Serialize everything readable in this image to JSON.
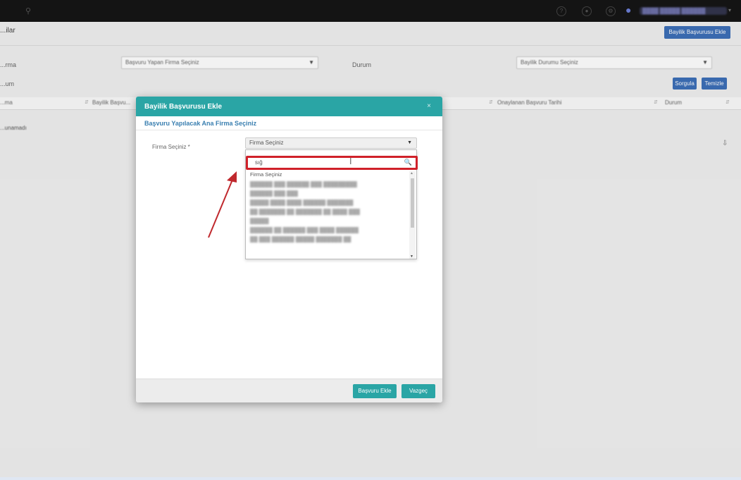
{
  "topbar": {
    "search_icon": "search-icon",
    "user_name": "████ █████ ██████"
  },
  "page": {
    "title": "...ilar",
    "add_button": "Bayilik Başvurusu Ekle",
    "filter_left_label": "...rma",
    "filter_left_value": "Başvuru Yapan Firma Seçiniz",
    "filter_right_label": "Durum",
    "filter_right_value": "Bayilik Durumu Seçiniz",
    "filter_row2_label": "...um",
    "search_button": "Sorgula",
    "clear_button": "Temizle",
    "table_headers": [
      "...ma",
      "Bayilik Başvu...",
      "Onaylanan Başvuru Tarihi",
      "Durum"
    ],
    "no_data": "...unamadı"
  },
  "modal": {
    "title": "Bayilik Başvurusu Ekle",
    "close_label": "× ",
    "subtitle": "Başvuru Yapılacak Ana Firma Seçiniz",
    "field_label": "Firma Seçiniz *",
    "select_value": "Firma Seçiniz",
    "search_value": "sığ",
    "options": [
      "Firma Seçiniz",
      "██████ ███ ██████ ███ █████████",
      "██████ ███ ███",
      "█████ ████ ████ ██████ ███████",
      "██ ███████ ██ ███████ ██ ████ ███",
      "█████",
      "██████ ██ ██████ ███ ████ ██████",
      "██ ███ ██████ █████ ███████ ██"
    ],
    "apply_button": "Başvuru Ekle",
    "cancel_button": "Vazgeç"
  },
  "colors": {
    "teal": "#2aa5a5",
    "blue": "#3d6fb8",
    "highlight_red": "#d0212a",
    "annotation_arrow": "#c0282d"
  }
}
